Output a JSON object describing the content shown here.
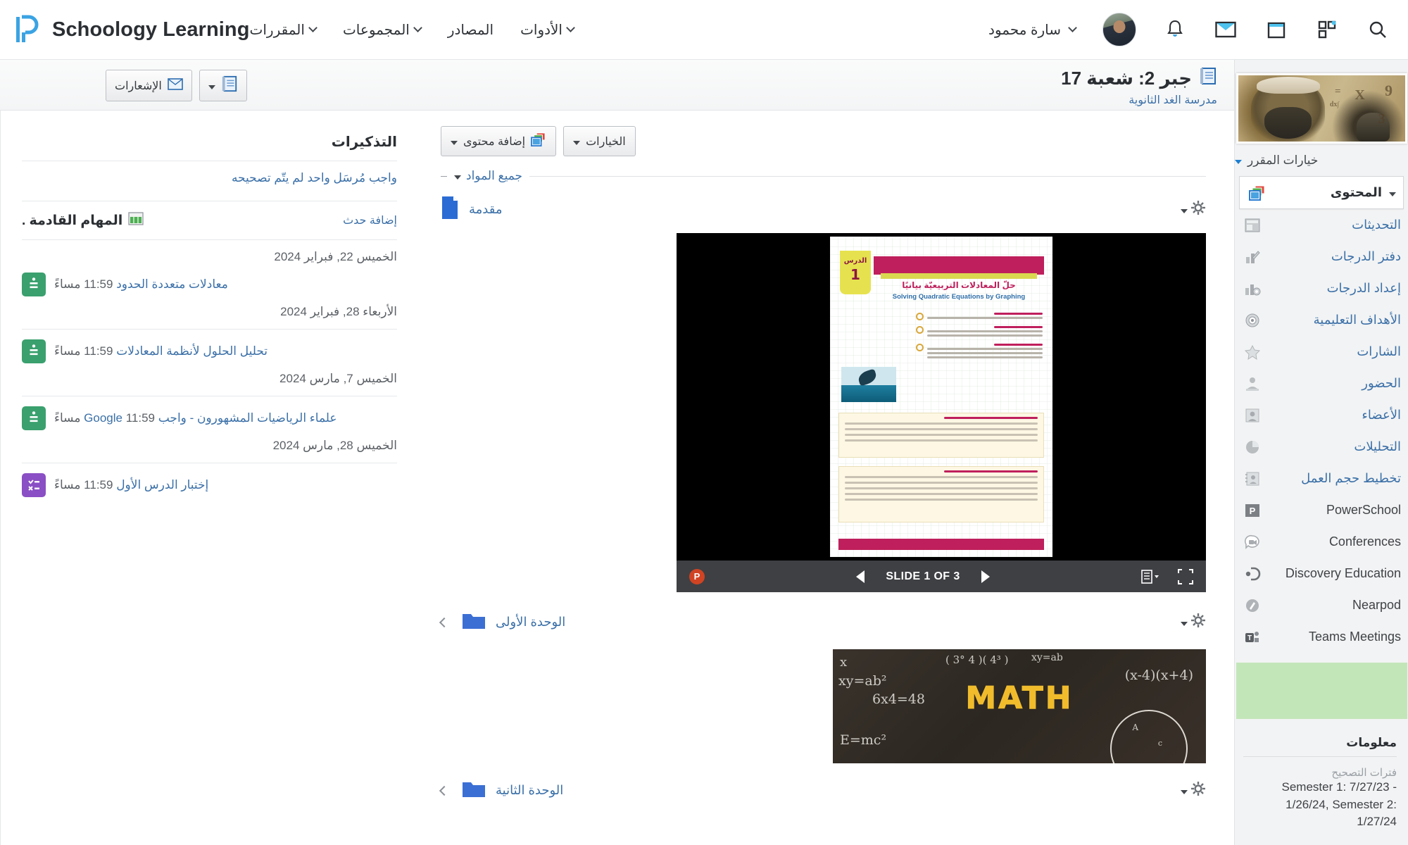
{
  "header": {
    "brand": "Schoology Learning",
    "brand_icon": "schoology-p-logo",
    "nav": [
      {
        "label": "المقررات",
        "icon": "chevron-down-icon"
      },
      {
        "label": "المجموعات",
        "icon": "chevron-down-icon"
      },
      {
        "label": "المصادر",
        "icon": "none"
      },
      {
        "label": "الأدوات",
        "icon": "chevron-down-icon"
      }
    ],
    "user_name": "سارة محمود",
    "icons": [
      "bell-icon",
      "envelope-icon",
      "calendar-icon",
      "apps-grid-icon",
      "search-icon"
    ]
  },
  "course": {
    "title": "جبر 2: شعبة 17",
    "title_icon": "notebook-icon",
    "subtitle": "مدرسة الغد الثانوية",
    "buttons": [
      {
        "label": "الإشعارات",
        "icon": "envelope-icon"
      },
      {
        "label": "",
        "icon": "notebook-icon"
      }
    ]
  },
  "reminders": {
    "title": "التذكيرات",
    "ungraded_link": "واجب مُرسَل واحد لم يتّم تصحيحه",
    "upcoming_title": "المهام القادمة .",
    "upcoming_icon": "calendar-green-icon",
    "add_event": "إضافة حدث",
    "groups": [
      {
        "date": "الخميس 22, فبراير 2024",
        "items": [
          {
            "name": "معادلات متعددة الحدود",
            "time": "11:59 مساءً",
            "type": "assignment"
          }
        ]
      },
      {
        "date": "الأربعاء 28, فبراير 2024",
        "items": [
          {
            "name": "تحليل الحلول لأنظمة المعادلات",
            "time": "11:59 مساءً",
            "type": "assignment"
          }
        ]
      },
      {
        "date": "الخميس 7, مارس 2024",
        "items": [
          {
            "name": "علماء الرياضيات المشهورون - واجب Google",
            "time": "11:59 مساءً",
            "type": "assignment"
          }
        ]
      },
      {
        "date": "الخميس 28, مارس 2024",
        "items": [
          {
            "name": "إختبار الدرس الأول",
            "time": "11:59 مساءً",
            "type": "quiz"
          }
        ]
      }
    ]
  },
  "content": {
    "add_content": "إضافة محتوى",
    "options": "الخيارات",
    "filter": "جميع المواد",
    "sections": [
      {
        "name": "مقدمة",
        "icon": "page-blue-icon",
        "gear": "gear-icon"
      },
      {
        "name": "الوحدة الأولى",
        "icon": "folder-blue-icon",
        "gear": "gear-icon"
      },
      {
        "name": "الوحدة الثانية",
        "icon": "folder-blue-icon",
        "gear": "gear-icon"
      }
    ],
    "viewer": {
      "slide_label": "SLIDE 1 OF 3",
      "app_icon": "powerpoint-icon",
      "prev_icon": "triangle-left-icon",
      "next_icon": "triangle-right-icon",
      "menu_icon": "list-menu-icon",
      "fullscreen_icon": "fullscreen-icon",
      "slide": {
        "lesson_word": "الدرس",
        "lesson_number": "1",
        "title_ar": "حلّ المعادلات التربيعيّة بيانيًا",
        "title_en": "Solving Quadratic Equations by Graphing"
      }
    },
    "board_word": "MATH",
    "board_formulas": [
      "xy=ab²",
      "6x4=48",
      "E=mc²",
      "(x+4)(x-4)",
      "4³",
      "xy=ab",
      "A",
      "c"
    ]
  },
  "sidebar": {
    "course_image": "scholar-portrait-banner",
    "course_options": "خيارات المقرر",
    "items": [
      {
        "label": "المحتوى",
        "icon": "content-icon",
        "active": true,
        "lang": "ar"
      },
      {
        "label": "التحديثات",
        "icon": "updates-icon",
        "active": false,
        "lang": "ar"
      },
      {
        "label": "دفتر الدرجات",
        "icon": "gradebook-icon",
        "active": false,
        "lang": "ar"
      },
      {
        "label": "إعداد الدرجات",
        "icon": "grade-setup-icon",
        "active": false,
        "lang": "ar"
      },
      {
        "label": "الأهداف التعليمية",
        "icon": "target-icon",
        "active": false,
        "lang": "ar"
      },
      {
        "label": "الشارات",
        "icon": "badge-star-icon",
        "active": false,
        "lang": "ar"
      },
      {
        "label": "الحضور",
        "icon": "attendance-icon",
        "active": false,
        "lang": "ar"
      },
      {
        "label": "الأعضاء",
        "icon": "members-icon",
        "active": false,
        "lang": "ar"
      },
      {
        "label": "التحليلات",
        "icon": "analytics-pie-icon",
        "active": false,
        "lang": "ar"
      },
      {
        "label": "تخطيط حجم العمل",
        "icon": "workload-icon",
        "active": false,
        "lang": "ar"
      },
      {
        "label": "PowerSchool",
        "icon": "powerschool-icon",
        "active": false,
        "lang": "en"
      },
      {
        "label": "Conferences",
        "icon": "video-conference-icon",
        "active": false,
        "lang": "en"
      },
      {
        "label": "Discovery Education",
        "icon": "discovery-education-icon",
        "active": false,
        "lang": "en"
      },
      {
        "label": "Nearpod",
        "icon": "nearpod-icon",
        "active": false,
        "lang": "en"
      },
      {
        "label": "Teams Meetings",
        "icon": "teams-icon",
        "active": false,
        "lang": "en"
      }
    ],
    "info": {
      "title": "معلومات",
      "grading_label": "فترات التصحيح",
      "grading_value": "Semester 1: 7/27/23 - 1/26/24, Semester 2: 1/27/24"
    }
  },
  "colors": {
    "brand_blue": "#3aa3e3",
    "link_blue": "#3b70a8",
    "folder_blue": "#3b6fd4",
    "assignment_green": "#3aa06e",
    "quiz_purple": "#8a4fc4",
    "sidebar_bg": "#f2f3f4",
    "green_block": "#c3e6b9"
  }
}
